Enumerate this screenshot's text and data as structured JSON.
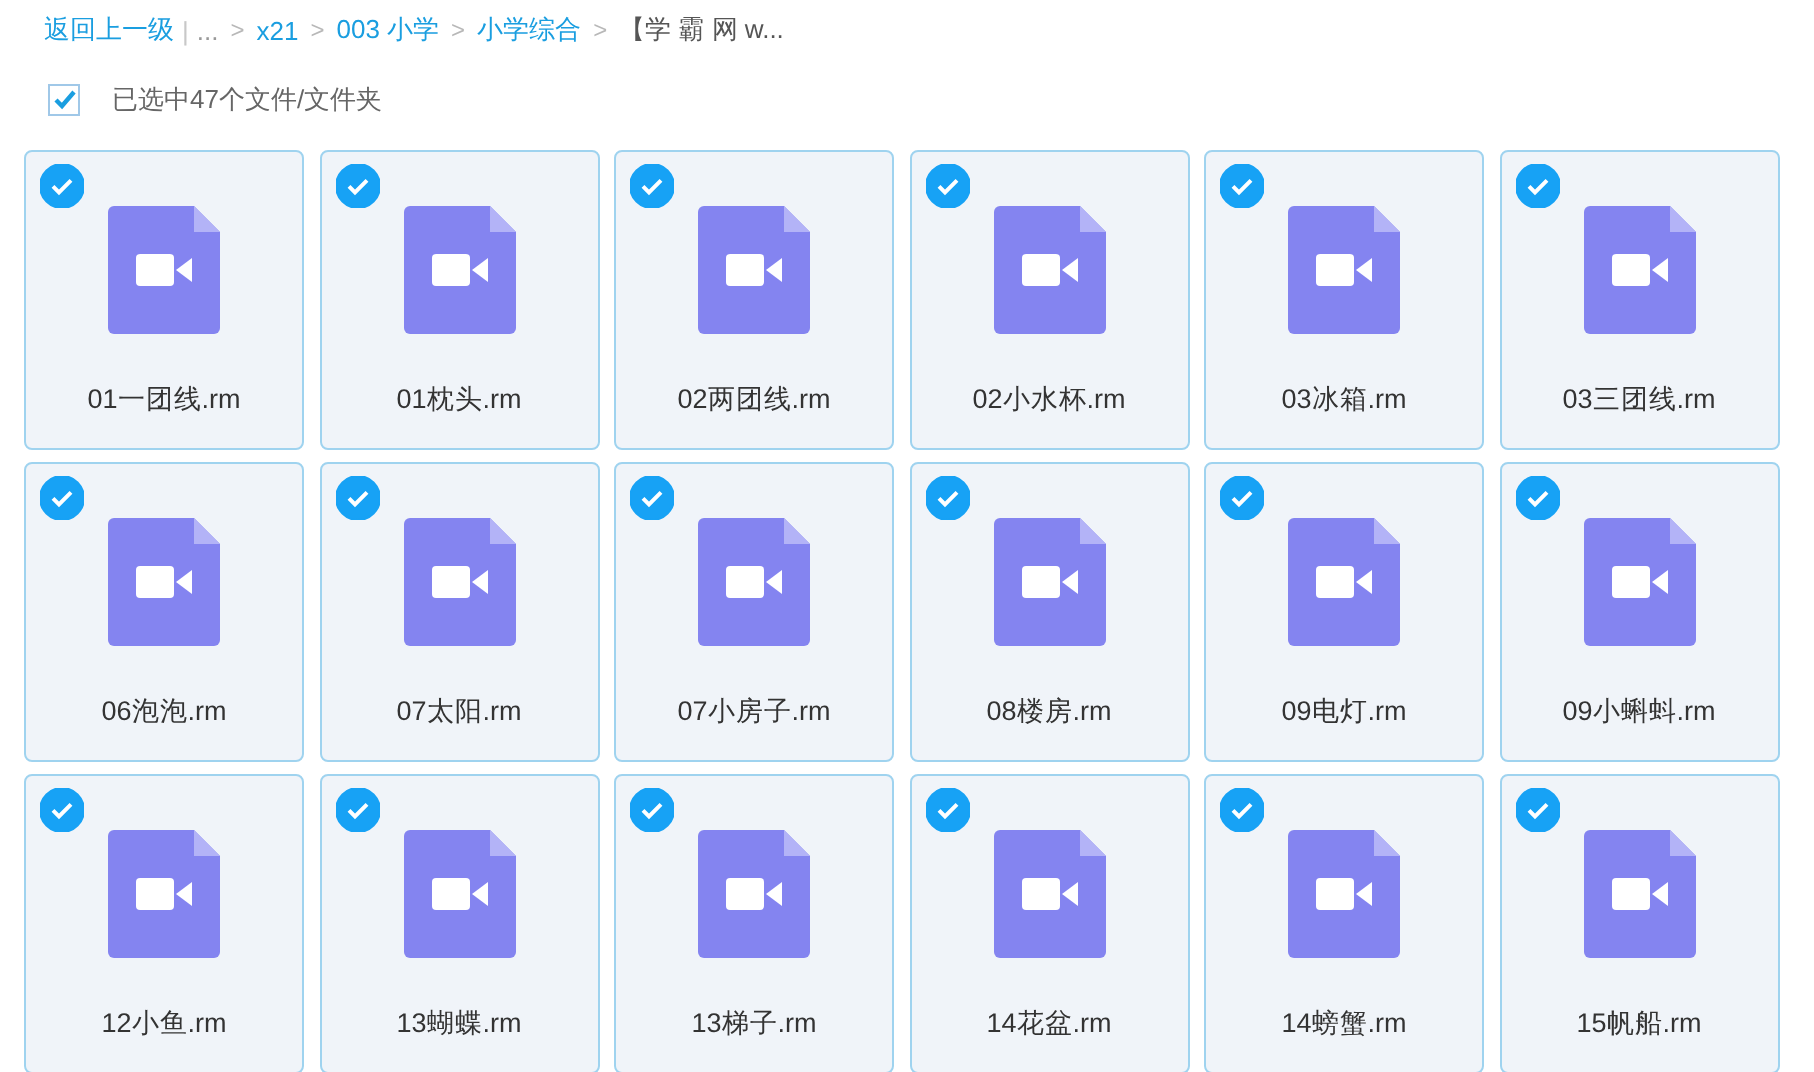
{
  "breadcrumb": {
    "back": "返回上一级",
    "separator": "|",
    "ellipsis": "...",
    "items": [
      {
        "label": "x21",
        "current": false
      },
      {
        "label": "003 小学",
        "current": false
      },
      {
        "label": "小学综合",
        "current": false
      },
      {
        "label": "【学 霸 网 w...",
        "current": true
      }
    ],
    "arrow": ">"
  },
  "selection": {
    "checked": true,
    "label": "已选中47个文件/文件夹"
  },
  "files": [
    {
      "name": "01一团线.rm",
      "selected": true
    },
    {
      "name": "01枕头.rm",
      "selected": true
    },
    {
      "name": "02两团线.rm",
      "selected": true
    },
    {
      "name": "02小水杯.rm",
      "selected": true
    },
    {
      "name": "03冰箱.rm",
      "selected": true
    },
    {
      "name": "03三团线.rm",
      "selected": true
    },
    {
      "name": "06泡泡.rm",
      "selected": true
    },
    {
      "name": "07太阳.rm",
      "selected": true
    },
    {
      "name": "07小房子.rm",
      "selected": true
    },
    {
      "name": "08楼房.rm",
      "selected": true
    },
    {
      "name": "09电灯.rm",
      "selected": true
    },
    {
      "name": "09小蝌蚪.rm",
      "selected": true
    },
    {
      "name": "12小鱼.rm",
      "selected": true
    },
    {
      "name": "13蝴蝶.rm",
      "selected": true
    },
    {
      "name": "13梯子.rm",
      "selected": true
    },
    {
      "name": "14花盆.rm",
      "selected": true
    },
    {
      "name": "14螃蟹.rm",
      "selected": true
    },
    {
      "name": "15帆船.rm",
      "selected": true
    }
  ]
}
